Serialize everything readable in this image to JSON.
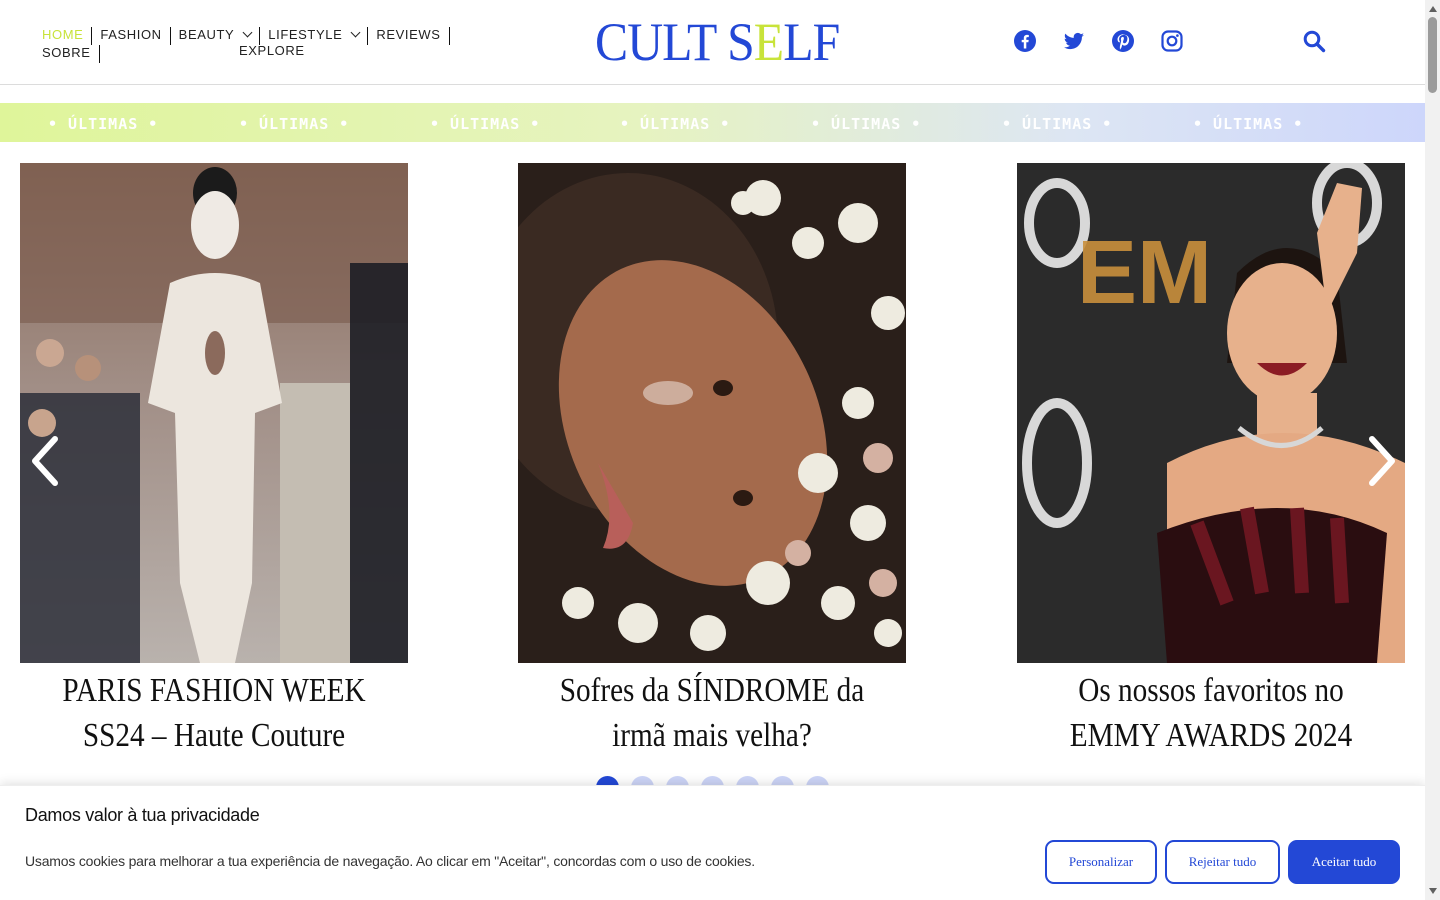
{
  "header": {
    "nav": [
      {
        "label": "HOME",
        "active": true
      },
      {
        "label": "FASHION"
      },
      {
        "label": "BEAUTY",
        "dropdown": true
      },
      {
        "label": "LIFESTYLE",
        "dropdown": true
      },
      {
        "label": "REVIEWS"
      },
      {
        "label": "SOBRE"
      }
    ],
    "nav_explore": "EXPLORE",
    "logo_left": "CULT S",
    "logo_e": "E",
    "logo_right": "LF",
    "socials": [
      "facebook-icon",
      "twitter-icon",
      "pinterest-icon",
      "instagram-icon"
    ],
    "search_icon": "search-icon"
  },
  "ticker": {
    "items": [
      "• ÚLTIMAS •",
      "• ÚLTIMAS •",
      "• ÚLTIMAS •",
      "• ÚLTIMAS •",
      "• ÚLTIMAS •",
      "• ÚLTIMAS •",
      "• ÚLTIMAS •"
    ]
  },
  "slider": {
    "cards": [
      {
        "title": "PARIS FASHION WEEK SS24 – Haute Couture"
      },
      {
        "title": "Sofres da SÍNDROME da irmã mais velha?"
      },
      {
        "title": "Os nossos favoritos no EMMY AWARDS 2024"
      }
    ],
    "dots_total": 7,
    "active_dot": 1
  },
  "cookie": {
    "title": "Damos valor à tua privacidade",
    "text": "Usamos cookies para melhorar a tua experiência de navegação. Ao clicar em \"Aceitar\",  concordas com o uso de cookies.",
    "customize_label": "Personalizar",
    "reject_label": "Rejeitar tudo",
    "accept_label": "Aceitar tudo"
  },
  "colors": {
    "brand_blue": "#2348d6",
    "accent_lime": "#c8e33a"
  }
}
